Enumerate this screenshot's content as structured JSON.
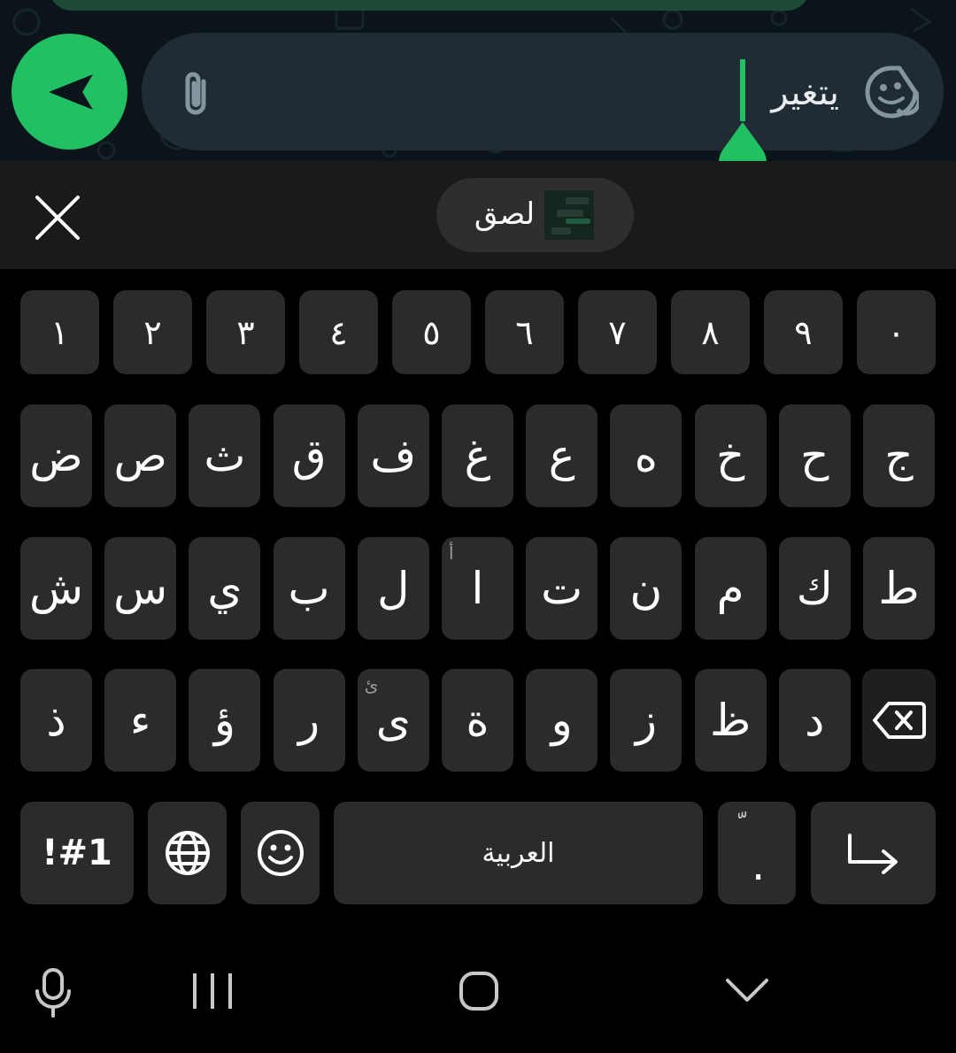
{
  "colors": {
    "accent": "#21c063",
    "chat_bg": "#0b141a",
    "input_bg": "#202c33",
    "key_bg": "#2b2b2b",
    "strip_bg": "#1a1a1a"
  },
  "compose": {
    "text": "يتغير",
    "send_icon": "send-icon",
    "attach_icon": "paperclip-icon",
    "sticker_icon": "sticker-icon"
  },
  "suggestion": {
    "close_icon": "close-icon",
    "paste_label": "لصق"
  },
  "keyboard": {
    "numbers": [
      "١",
      "٢",
      "٣",
      "٤",
      "٥",
      "٦",
      "٧",
      "٨",
      "٩",
      "٠"
    ],
    "row1": [
      "ض",
      "ص",
      "ث",
      "ق",
      "ف",
      "غ",
      "ع",
      "ه",
      "خ",
      "ح",
      "ج"
    ],
    "row2": [
      "ش",
      "س",
      "ي",
      "ب",
      "ل",
      "ا",
      "ت",
      "ن",
      "م",
      "ك",
      "ط"
    ],
    "row2_hint": "أ",
    "row3": [
      "ذ",
      "ء",
      "ؤ",
      "ر",
      "ى",
      "ة",
      "و",
      "ز",
      "ظ",
      "د"
    ],
    "row3_hint": "ئ",
    "symbols_label": "!#1",
    "space_label": "العربية",
    "period_label": ".",
    "period_hint": "ّ"
  }
}
